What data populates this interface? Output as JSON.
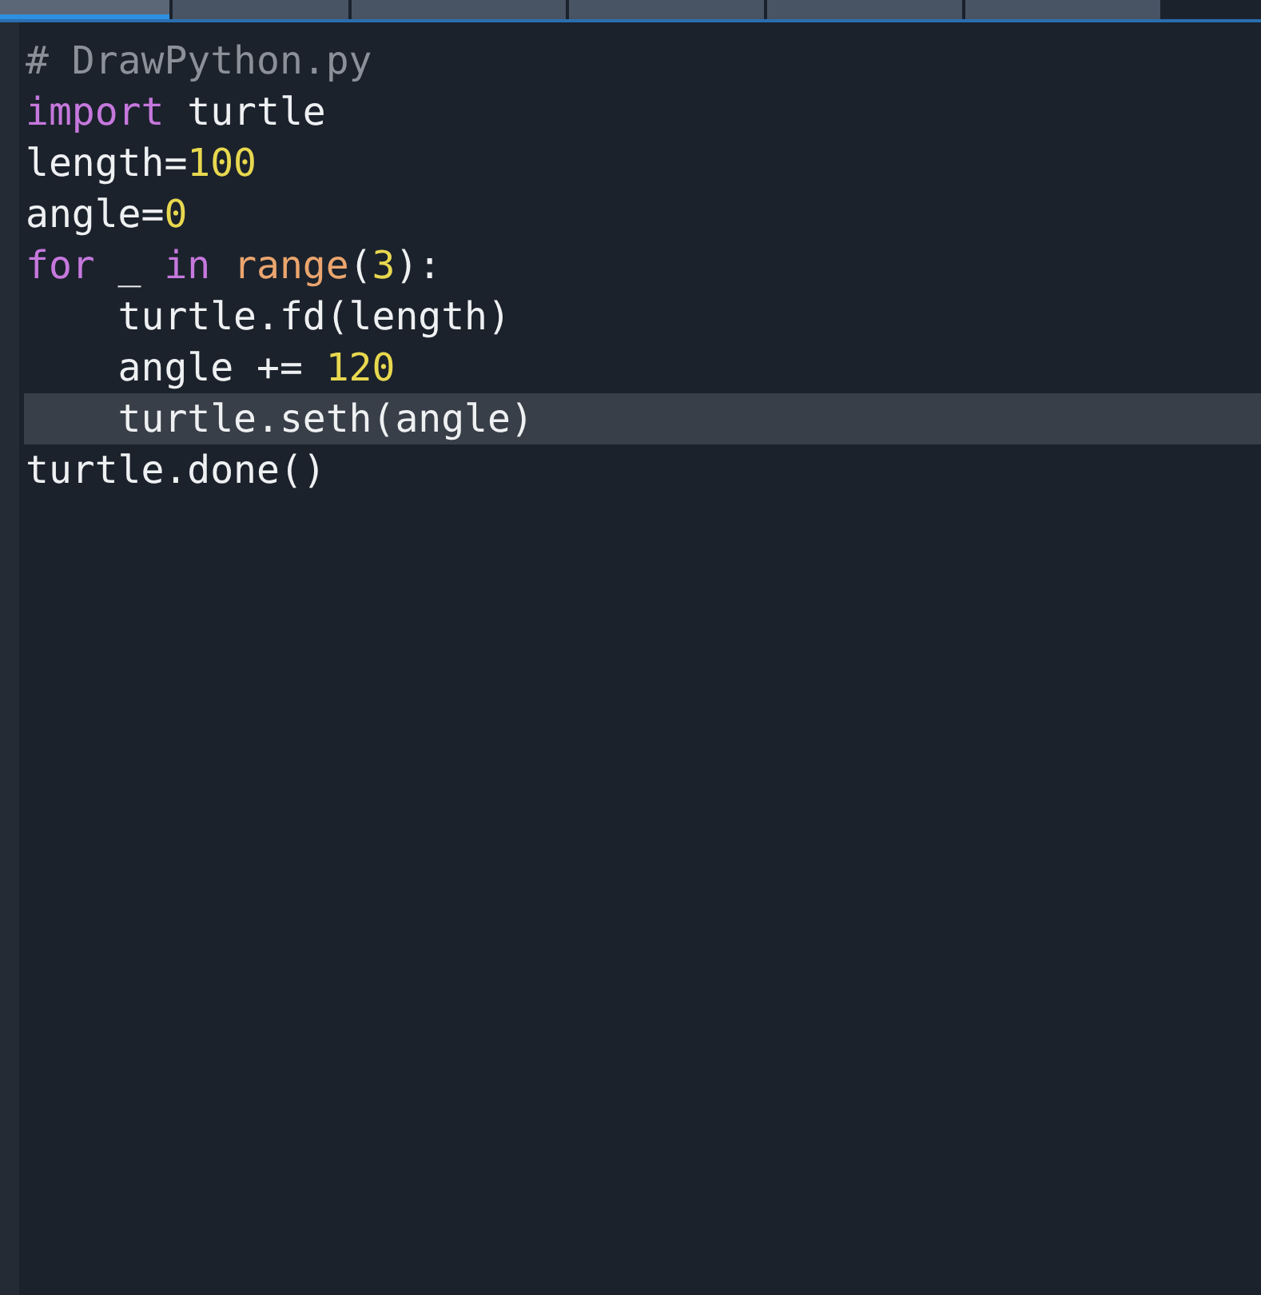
{
  "tabs": [
    {
      "selected": true
    },
    {
      "selected": false
    },
    {
      "selected": false
    },
    {
      "selected": false
    },
    {
      "selected": false
    },
    {
      "selected": false
    }
  ],
  "editor": {
    "lines": [
      {
        "current": false,
        "tokens": [
          {
            "kind": "comment",
            "text": "# DrawPython.py"
          }
        ]
      },
      {
        "current": false,
        "tokens": [
          {
            "kind": "keyword",
            "text": "import"
          },
          {
            "kind": "plain",
            "text": " turtle"
          }
        ]
      },
      {
        "current": false,
        "tokens": [
          {
            "kind": "plain",
            "text": "length="
          },
          {
            "kind": "number",
            "text": "100"
          }
        ]
      },
      {
        "current": false,
        "tokens": [
          {
            "kind": "plain",
            "text": "angle="
          },
          {
            "kind": "number",
            "text": "0"
          }
        ]
      },
      {
        "current": false,
        "tokens": [
          {
            "kind": "keyword",
            "text": "for"
          },
          {
            "kind": "plain",
            "text": " _ "
          },
          {
            "kind": "keyword",
            "text": "in "
          },
          {
            "kind": "builtin",
            "text": "range"
          },
          {
            "kind": "plain",
            "text": "("
          },
          {
            "kind": "number",
            "text": "3"
          },
          {
            "kind": "plain",
            "text": "):"
          }
        ]
      },
      {
        "current": false,
        "tokens": [
          {
            "kind": "plain",
            "text": "    turtle.fd(length)"
          }
        ]
      },
      {
        "current": false,
        "tokens": [
          {
            "kind": "plain",
            "text": "    angle += "
          },
          {
            "kind": "number",
            "text": "120"
          }
        ]
      },
      {
        "current": true,
        "tokens": [
          {
            "kind": "plain",
            "text": "    turtle.seth(angle)"
          }
        ]
      },
      {
        "current": false,
        "tokens": [
          {
            "kind": "plain",
            "text": "turtle.done()"
          }
        ]
      }
    ]
  }
}
